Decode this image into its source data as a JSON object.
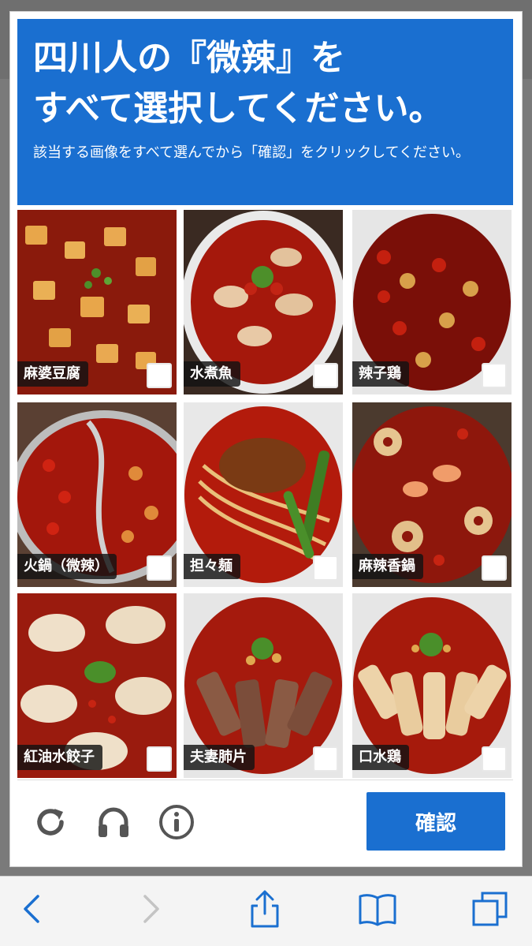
{
  "captcha": {
    "title_line1": "四川人の『微辣』を",
    "title_line2": "すべて選択してください。",
    "subtitle": "該当する画像をすべて選んでから「確認」をクリックしてください。",
    "accent_color": "#1a6fd0",
    "tiles": [
      {
        "label": "麻婆豆腐",
        "checked": false
      },
      {
        "label": "水煮魚",
        "checked": false
      },
      {
        "label": "辣子鶏",
        "checked": false
      },
      {
        "label": "火鍋（微辣）",
        "checked": false
      },
      {
        "label": "担々麺",
        "checked": false
      },
      {
        "label": "麻辣香鍋",
        "checked": false
      },
      {
        "label": "紅油水餃子",
        "checked": false
      },
      {
        "label": "夫妻肺片",
        "checked": false
      },
      {
        "label": "口水鶏",
        "checked": false
      }
    ],
    "footer": {
      "reload_icon": "reload-icon",
      "audio_icon": "headphones-icon",
      "info_icon": "info-icon",
      "confirm_label": "確認"
    }
  },
  "browser_toolbar": {
    "icons": [
      "back-icon",
      "forward-icon",
      "share-icon",
      "bookmarks-icon",
      "tabs-icon"
    ]
  }
}
